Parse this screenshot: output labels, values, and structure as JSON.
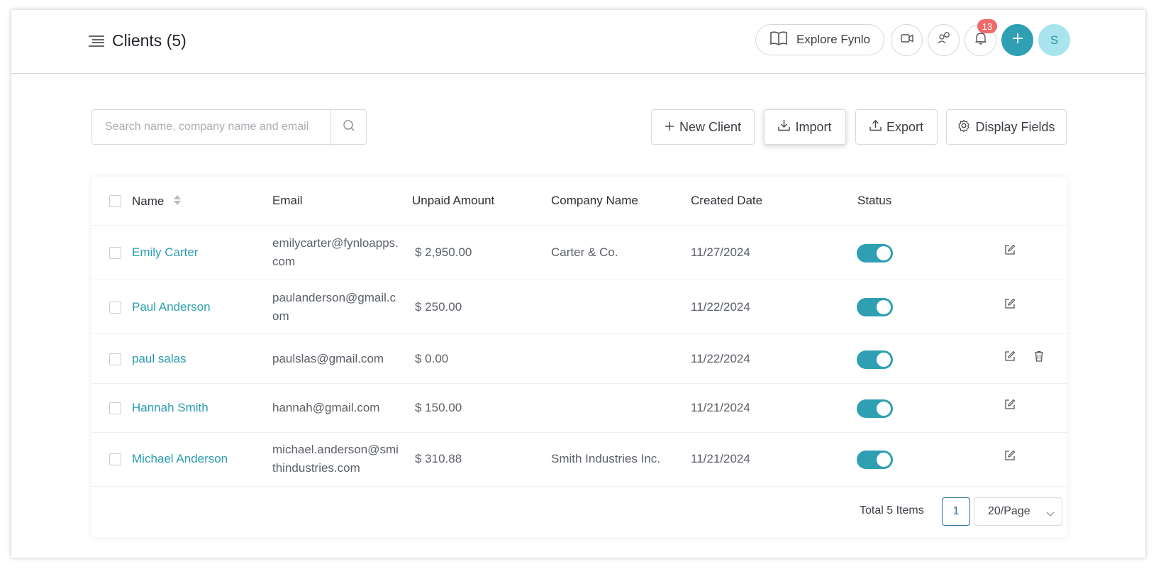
{
  "header": {
    "title": "Clients (5)",
    "explore_label": "Explore Fynlo",
    "notification_count": "13",
    "avatar_initial": "S"
  },
  "toolbar": {
    "search_placeholder": "Search name, company name and email",
    "new_client_label": "New Client",
    "import_label": "Import",
    "export_label": "Export",
    "display_fields_label": "Display Fields"
  },
  "table": {
    "columns": [
      "Name",
      "Email",
      "Unpaid Amount",
      "Company Name",
      "Created Date",
      "Status"
    ],
    "rows": [
      {
        "name": "Emily Carter",
        "email": "emilycarter@fynloapps.com",
        "unpaid": "$ 2,950.00",
        "company": "Carter & Co.",
        "created": "11/27/2024",
        "status": true,
        "deletable": false
      },
      {
        "name": "Paul Anderson",
        "email": "paulanderson@gmail.com",
        "unpaid": "$ 250.00",
        "company": "",
        "created": "11/22/2024",
        "status": true,
        "deletable": false
      },
      {
        "name": "paul salas",
        "email": "paulslas@gmail.com",
        "unpaid": "$ 0.00",
        "company": "",
        "created": "11/22/2024",
        "status": true,
        "deletable": true
      },
      {
        "name": "Hannah Smith",
        "email": "hannah@gmail.com",
        "unpaid": "$ 150.00",
        "company": "",
        "created": "11/21/2024",
        "status": true,
        "deletable": false
      },
      {
        "name": "Michael Anderson",
        "email": "michael.anderson@smithindustries.com",
        "unpaid": "$ 310.88",
        "company": "Smith Industries Inc.",
        "created": "11/21/2024",
        "status": true,
        "deletable": false
      }
    ]
  },
  "pagination": {
    "total_label": "Total 5 Items",
    "current_page": "1",
    "page_size": "20/Page"
  },
  "colors": {
    "accent": "#2f9fb3",
    "badge": "#f06a6a",
    "avatar_bg": "#a9e4ee"
  },
  "icons": [
    "menu-icon",
    "book-icon",
    "video-icon",
    "support-icon",
    "bell-icon",
    "plus-icon",
    "search-icon",
    "download-icon",
    "upload-icon",
    "gear-icon",
    "sort-icon",
    "edit-icon",
    "trash-icon",
    "chevron-down-icon"
  ]
}
